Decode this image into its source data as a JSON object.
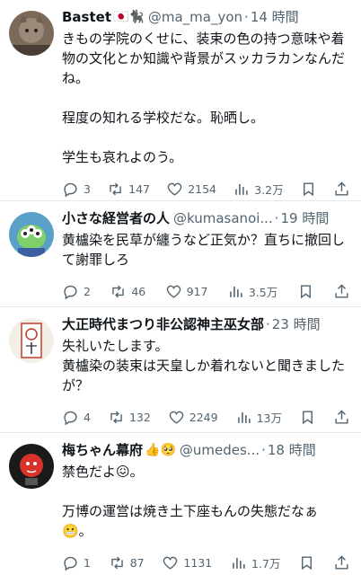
{
  "tweets": [
    {
      "name": "Bastet",
      "name_emoji": "🇯🇵🐈‍⬛",
      "handle": "@ma_ma_yon",
      "time": "14 時間",
      "text": "きもの学院のくせに、装束の色の持つ意味や着物の文化とか知識や背景がスッカラカンなんだね。\n\n程度の知れる学校だな。恥晒し。\n\n学生も哀れよのう。",
      "replies": "3",
      "retweets": "147",
      "likes": "2154",
      "views": "3.2万"
    },
    {
      "name": "小さな経営者の人",
      "name_emoji": "",
      "handle": "@kumasanoi...",
      "time": "19 時間",
      "text": "黄櫨染を民草が纏うなど正気か？直ちに撤回して謝罪しろ",
      "replies": "2",
      "retweets": "46",
      "likes": "917",
      "views": "3.5万"
    },
    {
      "name": "大正時代まつり非公認神主巫女部",
      "name_emoji": "",
      "handle": "",
      "time": "23 時間",
      "text": "失礼いたします。\n黄櫨染の装束は天皇しか着れないと聞きましたが？",
      "replies": "4",
      "retweets": "132",
      "likes": "2249",
      "views": "13万"
    },
    {
      "name": "梅ちゃん幕府",
      "name_emoji": "👍🥺",
      "handle": "@umedes...",
      "time": "18 時間",
      "text": "禁色だよ😖。\n\n万博の運営は焼き土下座もんの失態だなぁ\n😬。",
      "replies": "1",
      "retweets": "87",
      "likes": "1131",
      "views": "1.7万"
    }
  ],
  "colors": {
    "text": "#0f1419",
    "muted": "#536471",
    "divider": "#e6e9ec"
  },
  "icons": [
    "reply-icon",
    "retweet-icon",
    "like-icon",
    "views-icon",
    "bookmark-icon",
    "share-icon"
  ]
}
